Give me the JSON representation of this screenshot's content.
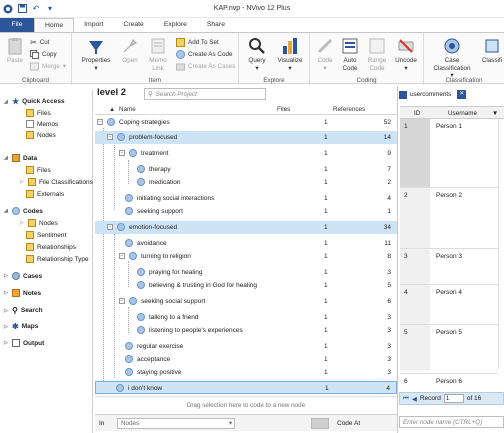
{
  "window": {
    "title": "KAP.nvp - NVivo 12 Plus"
  },
  "ribbon_tabs": [
    "File",
    "Home",
    "Import",
    "Create",
    "Explore",
    "Share"
  ],
  "ribbon": {
    "clipboard": {
      "label": "Clipboard",
      "paste": "Paste",
      "cut": "Cut",
      "copy": "Copy",
      "merge": "Merge"
    },
    "item": {
      "label": "Item",
      "properties": "Properties",
      "open": "Open",
      "memo_link": "Memo Link",
      "add_to_set": "Add To Set",
      "create_as_code": "Create As Code",
      "create_as_cases": "Create As Cases"
    },
    "explore": {
      "label": "Explore",
      "query": "Query",
      "visualize": "Visualize"
    },
    "coding": {
      "label": "Coding",
      "code": "Code",
      "auto_code": "Auto Code",
      "range_code": "Range Code",
      "uncode": "Uncode"
    },
    "classification": {
      "label": "Classification",
      "case_classification": "Case Classification",
      "classif": "Classifi"
    }
  },
  "nav": {
    "quick_access": "Quick Access",
    "qa_files": "Files",
    "qa_memos": "Memos",
    "qa_nodes": "Nodes",
    "data": "Data",
    "d_files": "Files",
    "d_file_classifications": "File Classifications",
    "d_externals": "Externals",
    "codes": "Codes",
    "c_nodes": "Nodes",
    "c_sentiment": "Sentiment",
    "c_relationships": "Relationships",
    "c_relationship_type": "Relationship Type",
    "cases": "Cases",
    "notes": "Notes",
    "search": "Search",
    "maps": "Maps",
    "output": "Output"
  },
  "project": {
    "title": "level 2",
    "search_placeholder": "Search Project",
    "col_name": "Name",
    "col_files": "Files",
    "col_refs": "References"
  },
  "nodes": [
    {
      "name": "Coping strategies",
      "files": "1",
      "refs": "52"
    },
    {
      "name": "problem-focused",
      "files": "1",
      "refs": "14"
    },
    {
      "name": "treatment",
      "files": "1",
      "refs": "9"
    },
    {
      "name": "therapy",
      "files": "1",
      "refs": "7"
    },
    {
      "name": "medication",
      "files": "1",
      "refs": "2"
    },
    {
      "name": "initiating social interactions",
      "files": "1",
      "refs": "4"
    },
    {
      "name": "seeking support",
      "files": "1",
      "refs": "1"
    },
    {
      "name": "emotion-focused",
      "files": "1",
      "refs": "34"
    },
    {
      "name": "avoidance",
      "files": "1",
      "refs": "11"
    },
    {
      "name": "turning to religion",
      "files": "1",
      "refs": "8"
    },
    {
      "name": "praying for healing",
      "files": "1",
      "refs": "3"
    },
    {
      "name": "believing & trusting in God for healing",
      "files": "1",
      "refs": "5"
    },
    {
      "name": "seeking social support",
      "files": "1",
      "refs": "6"
    },
    {
      "name": "talking to a friend",
      "files": "1",
      "refs": "3"
    },
    {
      "name": "listening to people's experiences",
      "files": "1",
      "refs": "3"
    },
    {
      "name": "regular exercise",
      "files": "1",
      "refs": "3"
    },
    {
      "name": "acceptance",
      "files": "1",
      "refs": "3"
    },
    {
      "name": "staying positive",
      "files": "1",
      "refs": "3"
    },
    {
      "name": "i don't know",
      "files": "1",
      "refs": "4"
    }
  ],
  "drag_hint": "Drag selection here to code to a new node",
  "bottom": {
    "in_label": "In",
    "in_value": "Nodes",
    "code_at": "Code At",
    "node_placeholder": "Enter node name (CTRL+Q)"
  },
  "right": {
    "tab": "usercomments",
    "col_id": "ID",
    "col_username": "Username",
    "rows": [
      {
        "id": "1",
        "name": "Person 1"
      },
      {
        "id": "2",
        "name": "Person 2"
      },
      {
        "id": "3",
        "name": "Person 3"
      },
      {
        "id": "4",
        "name": "Person 4"
      },
      {
        "id": "5",
        "name": "Person 5"
      },
      {
        "id": "6",
        "name": "Person 6"
      }
    ],
    "record_label": "Record",
    "record_value": "1",
    "record_of": "of 16"
  }
}
